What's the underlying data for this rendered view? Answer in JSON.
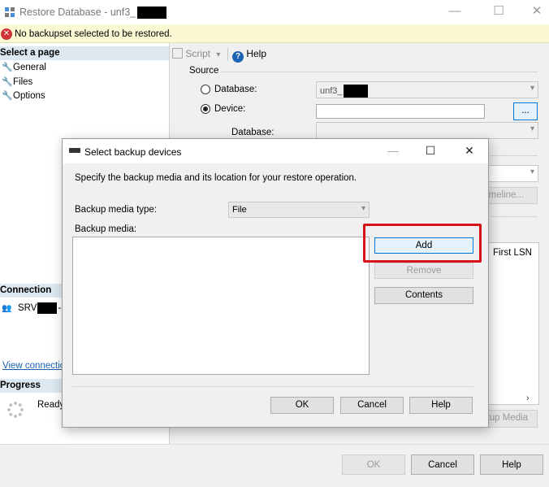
{
  "window": {
    "title": "Restore Database - unf3_",
    "minimize": "—",
    "maximize": "☐",
    "close": "✕"
  },
  "error": {
    "icon": "error-icon",
    "text": "No backupset selected to be restored."
  },
  "left_pane": {
    "select_page_header": "Select a page",
    "pages": [
      {
        "label": "General",
        "icon": "wrench-icon"
      },
      {
        "label": "Files",
        "icon": "wrench-icon"
      },
      {
        "label": "Options",
        "icon": "wrench-icon"
      }
    ],
    "connection_header": "Connection",
    "server_label": "SRV",
    "server_suffix": "-",
    "view_connection": "View connectio",
    "progress_header": "Progress",
    "progress_status": "Ready"
  },
  "toolbar": {
    "script_label": "Script",
    "script_dropdown": "▾",
    "help_label": "Help"
  },
  "source": {
    "header": "Source",
    "database_radio": "Database:",
    "database_value": "unf3_",
    "device_radio": "Device:",
    "device_browse": "...",
    "device_database_label": "Database:"
  },
  "background_fragments": {
    "timeline": "imeline...",
    "first_lsn": "First LSN",
    "backup_media": "kup Media"
  },
  "bottom": {
    "ok": "OK",
    "cancel": "Cancel",
    "help": "Help"
  },
  "dialog": {
    "title": "Select backup devices",
    "description": "Specify the backup media and its location for your restore operation.",
    "media_type_label": "Backup media type:",
    "media_type_value": "File",
    "media_label": "Backup media:",
    "add": "Add",
    "remove": "Remove",
    "contents": "Contents",
    "ok": "OK",
    "cancel": "Cancel",
    "help": "Help"
  },
  "colors": {
    "highlight": "#d6131b",
    "link": "#1a5fb4",
    "header_bg": "#dde8f0",
    "error_bg": "#fbf8d4"
  }
}
